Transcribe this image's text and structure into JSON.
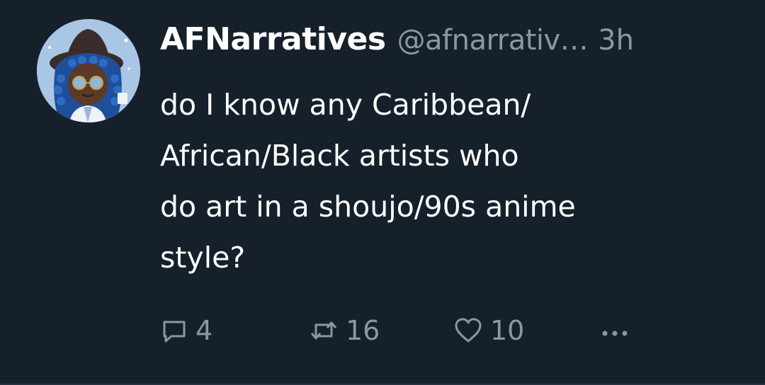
{
  "tweet": {
    "display_name": "AFNarratives",
    "handle": "@afnarrativ…",
    "timestamp": "3h",
    "text_lines": [
      "do I know any Caribbean/",
      "African/Black artists who",
      "do art in a shoujo/90s anime",
      "style?"
    ]
  },
  "actions": {
    "reply_icon": "reply-icon",
    "reply_count": "4",
    "retweet_icon": "retweet-icon",
    "retweet_count": "16",
    "like_icon": "heart-icon",
    "like_count": "10",
    "more_icon": "more-icon"
  },
  "colors": {
    "background": "#15202b",
    "text": "#ffffff",
    "secondary": "#8899a6",
    "avatar_bg": "#a9c6e4"
  }
}
